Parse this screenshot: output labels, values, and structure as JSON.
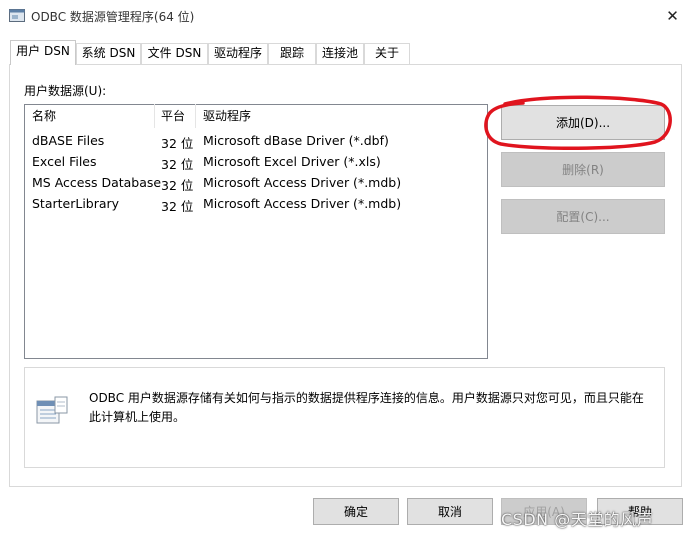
{
  "window": {
    "title": "ODBC 数据源管理程序(64 位)",
    "close_glyph": "✕"
  },
  "tabs": [
    {
      "label": "用户 DSN",
      "active": true
    },
    {
      "label": "系统 DSN",
      "active": false
    },
    {
      "label": "文件 DSN",
      "active": false
    },
    {
      "label": "驱动程序",
      "active": false
    },
    {
      "label": "跟踪",
      "active": false
    },
    {
      "label": "连接池",
      "active": false
    },
    {
      "label": "关于",
      "active": false
    }
  ],
  "user_dsn": {
    "label": "用户数据源(U):",
    "columns": [
      "名称",
      "平台",
      "驱动程序"
    ],
    "rows": [
      {
        "name": "dBASE Files",
        "platform": "32 位",
        "driver": "Microsoft dBase Driver (*.dbf)"
      },
      {
        "name": "Excel Files",
        "platform": "32 位",
        "driver": "Microsoft Excel Driver (*.xls)"
      },
      {
        "name": "MS Access Database",
        "platform": "32 位",
        "driver": "Microsoft Access Driver (*.mdb)"
      },
      {
        "name": "StarterLibrary",
        "platform": "32 位",
        "driver": "Microsoft Access Driver (*.mdb)"
      }
    ]
  },
  "buttons": {
    "add": "添加(D)...",
    "remove": "删除(R)",
    "configure": "配置(C)..."
  },
  "info": {
    "text": "ODBC 用户数据源存储有关如何与指示的数据提供程序连接的信息。用户数据源只对您可见，而且只能在此计算机上使用。",
    "icon": "data-source-icon"
  },
  "footer": {
    "ok": "确定",
    "cancel": "取消",
    "apply": "应用(A)",
    "help": "帮助"
  },
  "watermark": "CSDN @天堂的风声",
  "colors": {
    "annotation_red": "#e0141e",
    "disabled_button": "#cccccc",
    "button_face": "#e1e1e1"
  }
}
